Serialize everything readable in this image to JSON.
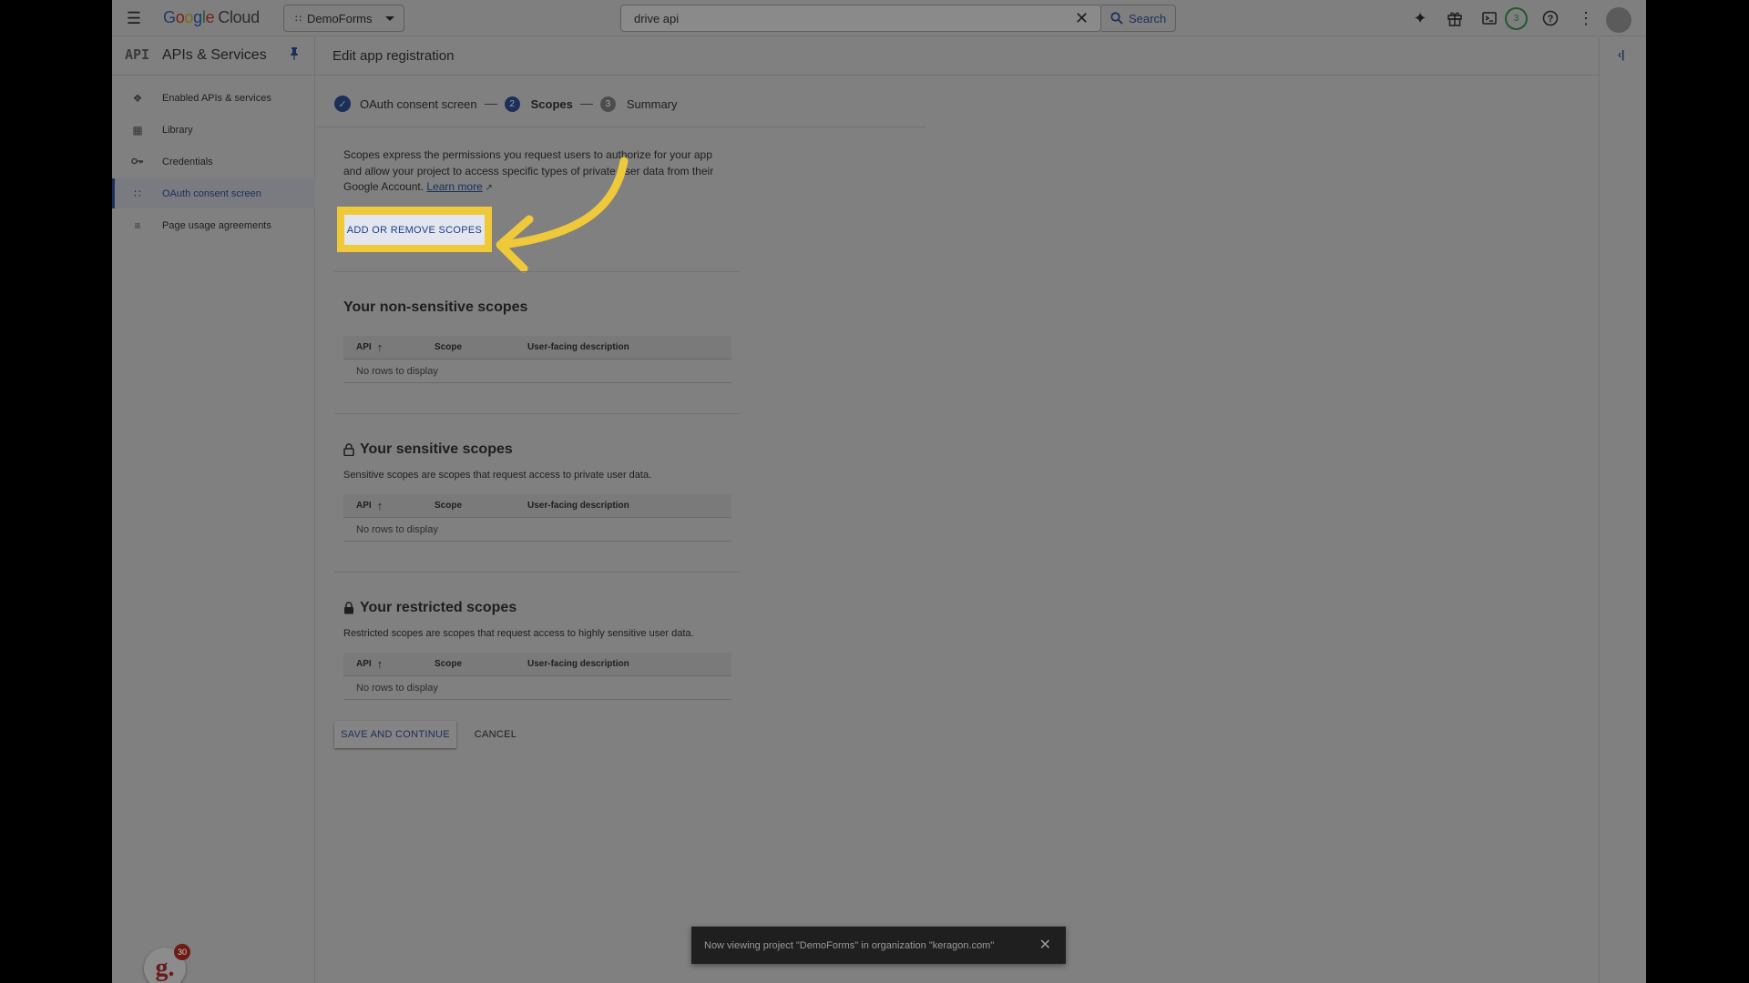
{
  "topbar": {
    "logo_parts": [
      "G",
      "o",
      "o",
      "g",
      "l",
      "e"
    ],
    "logo_cloud": "Cloud",
    "project": "DemoForms",
    "search_value": "drive api",
    "search_label": "Search",
    "notifications_count": "3"
  },
  "sidebar": {
    "api_mark": "API",
    "title": "APIs & Services",
    "items": [
      {
        "label": "Enabled APIs & services",
        "icon": "enabled-apis-icon"
      },
      {
        "label": "Library",
        "icon": "library-icon"
      },
      {
        "label": "Credentials",
        "icon": "key-icon"
      },
      {
        "label": "OAuth consent screen",
        "icon": "consent-icon",
        "active": true
      },
      {
        "label": "Page usage agreements",
        "icon": "agreements-icon"
      }
    ],
    "extension_badge_letter": "g.",
    "extension_badge_count": "30"
  },
  "main": {
    "page_title": "Edit app registration",
    "stepper": {
      "step1": "OAuth consent screen",
      "step2_num": "2",
      "step2": "Scopes",
      "step3_num": "3",
      "step3": "Summary"
    },
    "intro_text": "Scopes express the permissions you request users to authorize for your app and allow your project to access specific types of private user data from their Google Account.",
    "learn_more": "Learn more",
    "add_scopes_label": "ADD OR REMOVE SCOPES",
    "sections": [
      {
        "title": "Your non-sensitive scopes",
        "subtitle": "",
        "headers": [
          "API",
          "Scope",
          "User-facing description"
        ],
        "empty": "No rows to display"
      },
      {
        "title": "Your sensitive scopes",
        "subtitle": "Sensitive scopes are scopes that request access to private user data.",
        "headers": [
          "API",
          "Scope",
          "User-facing description"
        ],
        "empty": "No rows to display"
      },
      {
        "title": "Your restricted scopes",
        "subtitle": "Restricted scopes are scopes that request access to highly sensitive user data.",
        "headers": [
          "API",
          "Scope",
          "User-facing description"
        ],
        "empty": "No rows to display"
      }
    ],
    "save_label": "SAVE AND CONTINUE",
    "cancel_label": "CANCEL"
  },
  "toast": {
    "message": "Now viewing project \"DemoForms\" in organization \"keragon.com\""
  },
  "colors": {
    "accent": "#1b2f58",
    "highlight": "#efc93a"
  }
}
